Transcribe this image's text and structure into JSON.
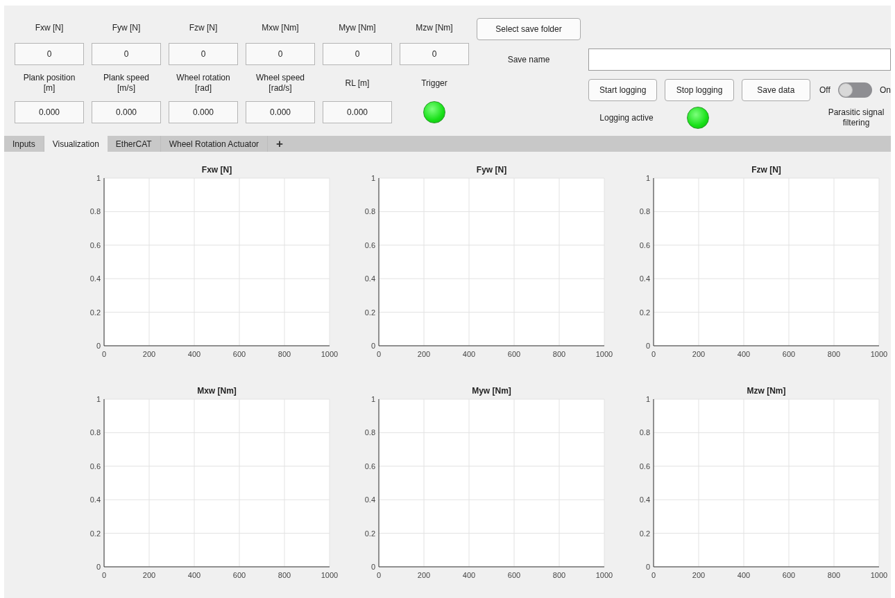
{
  "readouts": [
    {
      "label": "Fxw [N]",
      "value": "0"
    },
    {
      "label": "Fyw [N]",
      "value": "0"
    },
    {
      "label": "Fzw [N]",
      "value": "0"
    },
    {
      "label": "Mxw [Nm]",
      "value": "0"
    },
    {
      "label": "Myw [Nm]",
      "value": "0"
    },
    {
      "label": "Mzw [Nm]",
      "value": "0"
    }
  ],
  "positions": [
    {
      "label": "Plank position [m]",
      "value": "0.000"
    },
    {
      "label": "Plank speed [m/s]",
      "value": "0.000"
    },
    {
      "label": "Wheel rotation [rad]",
      "value": "0.000"
    },
    {
      "label": "Wheel speed [rad/s]",
      "value": "0.000"
    },
    {
      "label": "RL [m]",
      "value": "0.000"
    }
  ],
  "trigger": {
    "label": "Trigger",
    "on": true
  },
  "select_folder_button": "Select save folder",
  "save_name": {
    "label": "Save name"
  },
  "logging_buttons": [
    "Start logging",
    "Stop logging",
    "Save data"
  ],
  "filter_switch": {
    "off_label": "Off",
    "on_label": "On",
    "on": false,
    "caption": "Parasitic signal filtering"
  },
  "logging_indicator": {
    "label": "Logging active",
    "on": true
  },
  "tabs": [
    {
      "label": "Inputs",
      "selected": false
    },
    {
      "label": "Visualization",
      "selected": true
    },
    {
      "label": "EtherCAT",
      "selected": false
    },
    {
      "label": "Wheel Rotation Actuator",
      "selected": false
    }
  ],
  "add_tab": "+",
  "charts": [
    {
      "chart_data": {
        "type": "line",
        "grid": true,
        "title": "Fxw [N]",
        "xlim": [
          0,
          1000
        ],
        "ylim": [
          0,
          1
        ],
        "xticks": [
          0,
          200,
          400,
          600,
          800,
          1000
        ],
        "yticks": [
          0,
          0.2,
          0.4,
          0.6,
          0.8,
          1
        ]
      }
    },
    {
      "chart_data": {
        "type": "line",
        "grid": true,
        "title": "Fyw [N]",
        "xlim": [
          0,
          1000
        ],
        "ylim": [
          0,
          1
        ],
        "xticks": [
          0,
          200,
          400,
          600,
          800,
          1000
        ],
        "yticks": [
          0,
          0.2,
          0.4,
          0.6,
          0.8,
          1
        ]
      }
    },
    {
      "chart_data": {
        "type": "line",
        "grid": true,
        "title": "Fzw [N]",
        "xlim": [
          0,
          1000
        ],
        "ylim": [
          0,
          1
        ],
        "xticks": [
          0,
          200,
          400,
          600,
          800,
          1000
        ],
        "yticks": [
          0,
          0.2,
          0.4,
          0.6,
          0.8,
          1
        ]
      }
    },
    {
      "chart_data": {
        "type": "line",
        "grid": true,
        "title": "Mxw [Nm]",
        "xlim": [
          0,
          1000
        ],
        "ylim": [
          0,
          1
        ],
        "xticks": [
          0,
          200,
          400,
          600,
          800,
          1000
        ],
        "yticks": [
          0,
          0.2,
          0.4,
          0.6,
          0.8,
          1
        ]
      }
    },
    {
      "chart_data": {
        "type": "line",
        "grid": true,
        "title": "Myw [Nm]",
        "xlim": [
          0,
          1000
        ],
        "ylim": [
          0,
          1
        ],
        "xticks": [
          0,
          200,
          400,
          600,
          800,
          1000
        ],
        "yticks": [
          0,
          0.2,
          0.4,
          0.6,
          0.8,
          1
        ]
      }
    },
    {
      "chart_data": {
        "type": "line",
        "grid": true,
        "title": "Mzw [Nm]",
        "xlim": [
          0,
          1000
        ],
        "ylim": [
          0,
          1
        ],
        "xticks": [
          0,
          200,
          400,
          600,
          800,
          1000
        ],
        "yticks": [
          0,
          0.2,
          0.4,
          0.6,
          0.8,
          1
        ]
      }
    }
  ]
}
